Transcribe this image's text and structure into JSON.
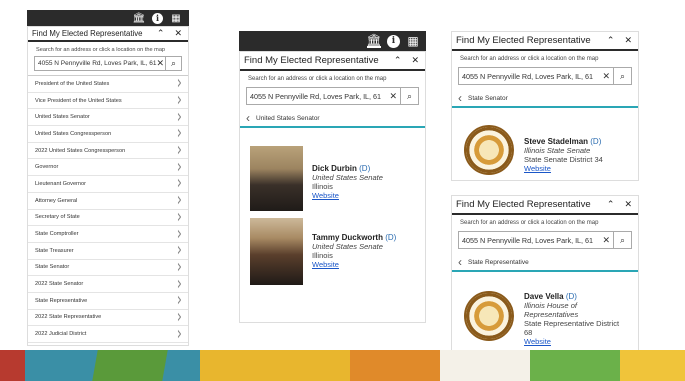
{
  "colors": {
    "toolbar": "#2b2b2b",
    "accent": "#2aa6b5",
    "link": "#1a56c8",
    "party": "#2b6cb0"
  },
  "toolbar_icons": [
    "library-icon",
    "info-icon",
    "grid-icon"
  ],
  "panel_left": {
    "title": "Find My Elected Representative",
    "hint": "Search for an address or click a location on the map",
    "search_value": "4055 N Pennyville Rd, Loves Park, IL, 61",
    "offices": [
      "President of the United States",
      "Vice President of the United States",
      "United States Senator",
      "United States Congressperson",
      "2022 United States Congressperson",
      "Governor",
      "Lieutenant Governor",
      "Attorney General",
      "Secretary of State",
      "State Comptroller",
      "State Treasurer",
      "State Senator",
      "2022 State Senator",
      "State Representative",
      "2022 State Representative",
      "2022 Judicial District"
    ]
  },
  "panel_middle": {
    "title": "Find My Elected Representative",
    "hint": "Search for an address or click a location on the map",
    "search_value": "4055 N Pennyville Rd, Loves Park, IL, 61",
    "crumb": "United States Senator",
    "reps": [
      {
        "name": "Dick Durbin",
        "party": "(D)",
        "office": "United States Senate",
        "state": "Illinois",
        "link": "Website"
      },
      {
        "name": "Tammy Duckworth",
        "party": "(D)",
        "office": "United States Senate",
        "state": "Illinois",
        "link": "Website"
      }
    ]
  },
  "panel_right_top": {
    "title": "Find My Elected Representative",
    "hint": "Search for an address or click a location on the map",
    "search_value": "4055 N Pennyville Rd, Loves Park, IL, 61",
    "crumb": "State Senator",
    "rep": {
      "name": "Steve Stadelman",
      "party": "(D)",
      "office": "Illinois State Senate",
      "district": "State Senate District 34",
      "link": "Website"
    }
  },
  "panel_right_bottom": {
    "title": "Find My Elected Representative",
    "hint": "Search for an address or click a location on the map",
    "search_value": "4055 N Pennyville Rd, Loves Park, IL, 61",
    "crumb": "State Representative",
    "rep": {
      "name": "Dave Vella",
      "party": "(D)",
      "office_line1": "Illinois House of",
      "office_line2": "Representatives",
      "district_line1": "State Representative District",
      "district_line2": "68",
      "link": "Website"
    }
  }
}
